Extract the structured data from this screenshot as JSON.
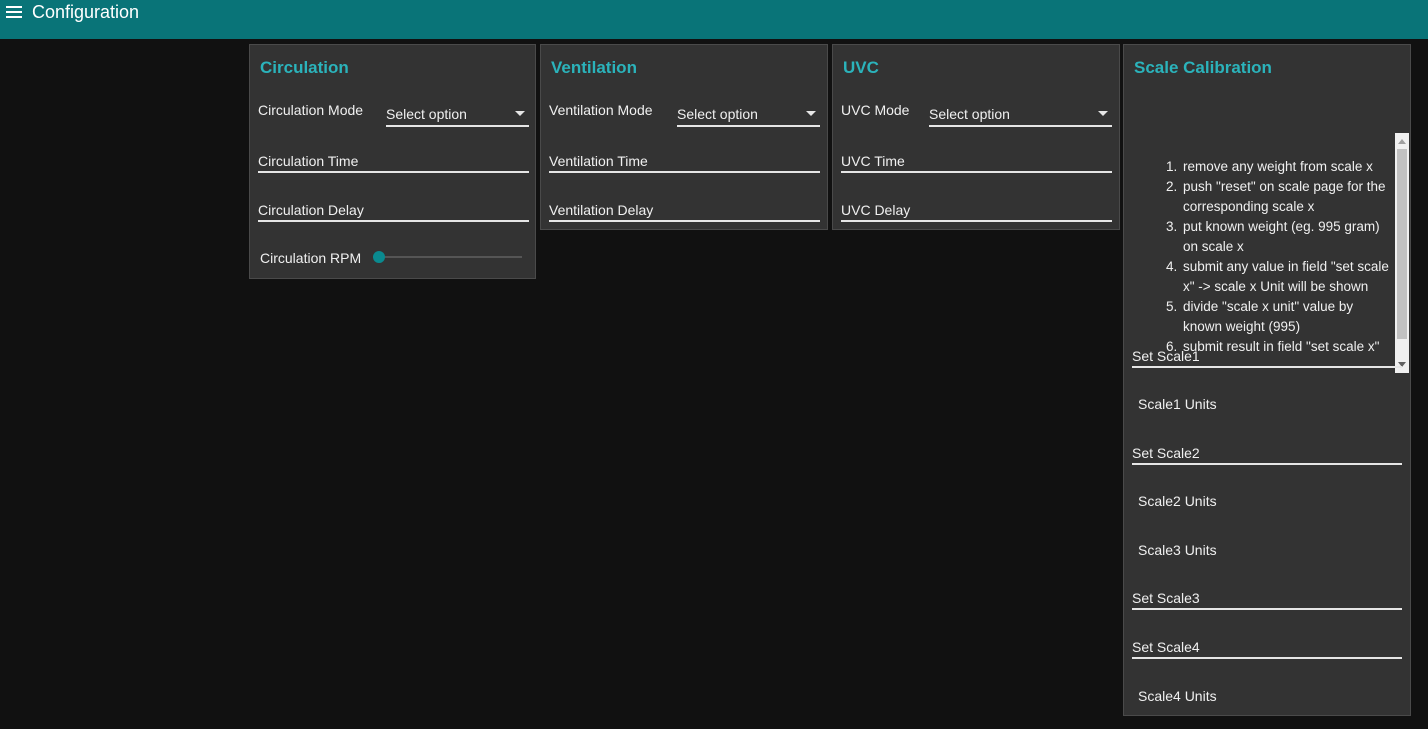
{
  "header": {
    "title": "Configuration",
    "menu_icon": "hamburger-menu-icon",
    "background_color": "#097478"
  },
  "accent_color": "#2bb3bb",
  "circulation": {
    "title": "Circulation",
    "mode_label": "Circulation Mode",
    "mode_value": "Select option",
    "time_label": "Circulation Time",
    "delay_label": "Circulation Delay",
    "rpm_label": "Circulation RPM",
    "rpm_fraction": 0
  },
  "ventilation": {
    "title": "Ventilation",
    "mode_label": "Ventilation Mode",
    "mode_value": "Select option",
    "time_label": "Ventilation Time",
    "delay_label": "Ventilation Delay"
  },
  "uvc": {
    "title": "UVC",
    "mode_label": "UVC Mode",
    "mode_value": "Select option",
    "time_label": "UVC Time",
    "delay_label": "UVC Delay"
  },
  "scale_calibration": {
    "title": "Scale Calibration",
    "steps": [
      "remove any weight from scale x",
      "push \"reset\" on scale page for the corresponding scale x",
      "put known weight (eg. 995 gram) on scale x",
      "submit any value in field \"set scale x\" -> scale x Unit will be shown",
      "divide \"scale x unit\" value by known weight (995)",
      "submit result in field \"set scale x\""
    ],
    "set_scale1": "Set Scale1",
    "scale1_units": "Scale1 Units",
    "set_scale2": "Set Scale2",
    "scale2_units": "Scale2 Units",
    "scale3_units": "Scale3 Units",
    "set_scale3": "Set Scale3",
    "set_scale4": "Set Scale4",
    "scale4_units": "Scale4 Units"
  }
}
